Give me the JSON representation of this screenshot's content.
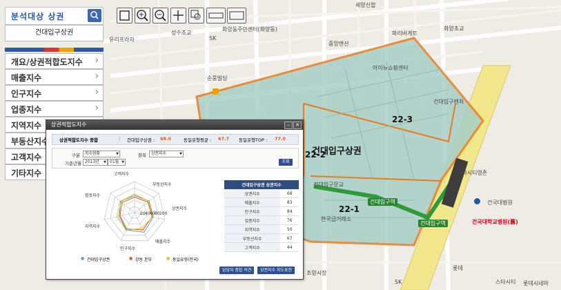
{
  "left_panel": {
    "title": "분석대상 상권",
    "search_icon": "search-icon",
    "selected_area": "건대입구상권",
    "menu": [
      {
        "label": "개요/상권적합도지수"
      },
      {
        "label": "매출지수"
      },
      {
        "label": "인구지수"
      },
      {
        "label": "업종지수"
      },
      {
        "label": "지역지수"
      },
      {
        "label": "부동산지수"
      },
      {
        "label": "고객지수"
      },
      {
        "label": "기타지수"
      }
    ]
  },
  "toolbar": {
    "tools": [
      "full-extent-icon",
      "zoom-in-icon",
      "zoom-out-icon",
      "pan-icon",
      "zoom-box-icon",
      "distance-ruler-icon",
      "area-measure-icon"
    ]
  },
  "map": {
    "labels": {
      "l1": "세양신합",
      "l2": "화양동주민센터(화양동)",
      "l3": "파리바게트",
      "l4": "화양초교",
      "l5": "성수초교",
      "l6": "유리프라자",
      "l7": "SK",
      "l8": "중앙맨션",
      "l9": "순풍빌딩",
      "l10": "아이뉴쇼핑센터",
      "l11": "건대입구문교",
      "l12": "건대입구벤처",
      "l13": "스타시티영존",
      "l14": "건국대병원",
      "l15": "한국금거래소",
      "l16": "조양시장",
      "l17": "SK",
      "l18": "롯데",
      "l19": "스타시티",
      "l20": "롯데시네마"
    },
    "area_labels": {
      "a1": "22-3",
      "a2": "22-2",
      "a3": "22-1"
    },
    "zone_label": "건대입구상권",
    "stations": {
      "s1": "건대입구역",
      "s2": "건대입구역"
    },
    "hospital": "건국대학교병원(舊)",
    "colors": {
      "zone_fill": "#a8cfc6",
      "zone_border": "#e87b1e",
      "subway_line": "#2e9a3a",
      "road": "#ffffff"
    }
  },
  "popup": {
    "title": "상권적합도지수",
    "summary": {
      "label": "상권적합도지수 종합",
      "item1_label": "건대입구상권 :",
      "item1_value": "68.0",
      "item2_label": "동일유형평균 :",
      "item2_value": "67.7",
      "item3_label": "동일유형TOP :",
      "item3_value": "77.0"
    },
    "filter": {
      "gubun_label": "구분",
      "gubun_value": "지수현황",
      "item_label": "항목",
      "item_value": "상권지수",
      "date_label": "기준년월",
      "year_value": "2013년",
      "month_value": "01월",
      "search_label": "조회"
    },
    "radar": {
      "axes": [
        "고객지수",
        "부동산지수",
        "상권지수",
        "매출지수",
        "인구지수",
        "지역지수",
        "점포지수"
      ],
      "rings": [
        "20",
        "40",
        "60",
        "80",
        "100"
      ]
    },
    "legend": {
      "l1": "건대입구상권",
      "l2": "강동 본부",
      "l3": "동일유형(전국)"
    },
    "table": {
      "header": "건대입구상권 상권지수",
      "rows": [
        {
          "name": "상권지수",
          "value": "68"
        },
        {
          "name": "매출지수",
          "value": "83"
        },
        {
          "name": "인구지수",
          "value": "84"
        },
        {
          "name": "업종지수",
          "value": "76"
        },
        {
          "name": "지역지수",
          "value": "50"
        },
        {
          "name": "부동산지수",
          "value": "67"
        },
        {
          "name": "고객지수",
          "value": "44"
        }
      ]
    },
    "buttons": {
      "b1": "담당자 종합 의견",
      "b2": "상권지수 지도표현"
    }
  }
}
